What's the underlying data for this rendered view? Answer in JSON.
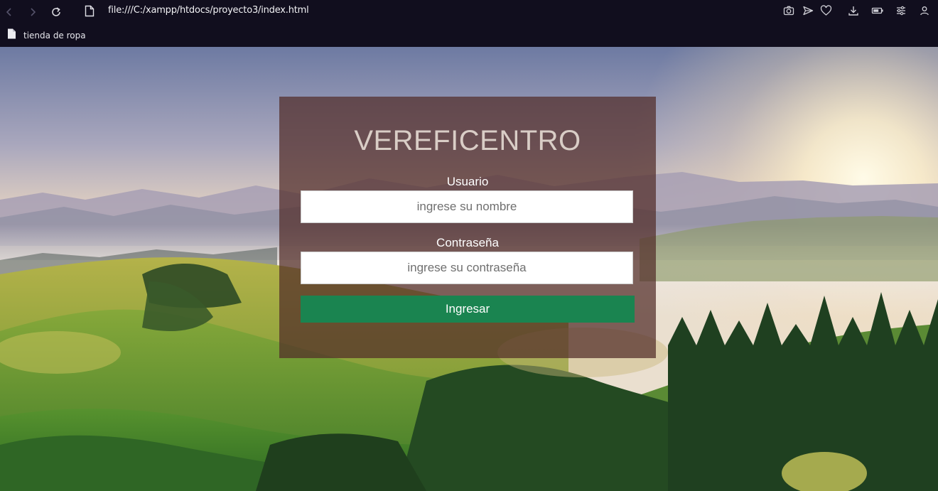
{
  "browser": {
    "url": "file:///C:/xampp/htdocs/proyecto3/index.html",
    "bookmarks": [
      {
        "label": "tienda de ropa"
      }
    ],
    "icons": {
      "back": "back-arrow-icon",
      "forward": "forward-arrow-icon",
      "reload": "reload-icon",
      "page": "page-icon",
      "snapshot": "camera-icon",
      "send": "send-icon",
      "favorite": "heart-icon",
      "download": "download-icon",
      "battery": "battery-icon",
      "settings": "easy-setup-icon",
      "profile": "profile-icon"
    }
  },
  "page": {
    "title": "VEREFICENTRO",
    "user_label": "Usuario",
    "user_placeholder": "ingrese su nombre",
    "password_label": "Contraseña",
    "password_placeholder": "ingrese su contraseña",
    "submit_label": "Ingresar",
    "colors": {
      "card": "#522d28",
      "button": "#1a8450",
      "chrome": "#110e1e"
    }
  }
}
